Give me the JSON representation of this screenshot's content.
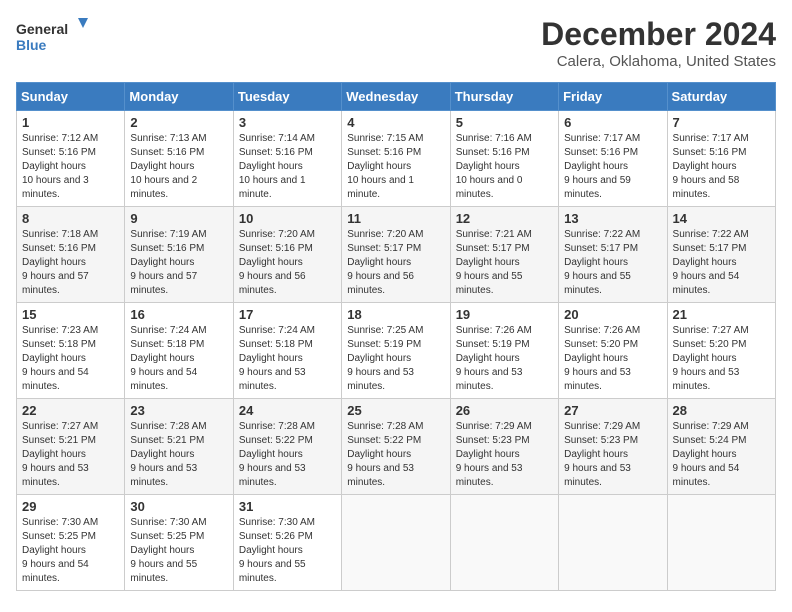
{
  "logo": {
    "line1": "General",
    "line2": "Blue"
  },
  "title": "December 2024",
  "subtitle": "Calera, Oklahoma, United States",
  "days_of_week": [
    "Sunday",
    "Monday",
    "Tuesday",
    "Wednesday",
    "Thursday",
    "Friday",
    "Saturday"
  ],
  "weeks": [
    [
      {
        "day": "1",
        "sunrise": "7:12 AM",
        "sunset": "5:16 PM",
        "daylight": "10 hours and 3 minutes."
      },
      {
        "day": "2",
        "sunrise": "7:13 AM",
        "sunset": "5:16 PM",
        "daylight": "10 hours and 2 minutes."
      },
      {
        "day": "3",
        "sunrise": "7:14 AM",
        "sunset": "5:16 PM",
        "daylight": "10 hours and 1 minute."
      },
      {
        "day": "4",
        "sunrise": "7:15 AM",
        "sunset": "5:16 PM",
        "daylight": "10 hours and 1 minute."
      },
      {
        "day": "5",
        "sunrise": "7:16 AM",
        "sunset": "5:16 PM",
        "daylight": "10 hours and 0 minutes."
      },
      {
        "day": "6",
        "sunrise": "7:17 AM",
        "sunset": "5:16 PM",
        "daylight": "9 hours and 59 minutes."
      },
      {
        "day": "7",
        "sunrise": "7:17 AM",
        "sunset": "5:16 PM",
        "daylight": "9 hours and 58 minutes."
      }
    ],
    [
      {
        "day": "8",
        "sunrise": "7:18 AM",
        "sunset": "5:16 PM",
        "daylight": "9 hours and 57 minutes."
      },
      {
        "day": "9",
        "sunrise": "7:19 AM",
        "sunset": "5:16 PM",
        "daylight": "9 hours and 57 minutes."
      },
      {
        "day": "10",
        "sunrise": "7:20 AM",
        "sunset": "5:16 PM",
        "daylight": "9 hours and 56 minutes."
      },
      {
        "day": "11",
        "sunrise": "7:20 AM",
        "sunset": "5:17 PM",
        "daylight": "9 hours and 56 minutes."
      },
      {
        "day": "12",
        "sunrise": "7:21 AM",
        "sunset": "5:17 PM",
        "daylight": "9 hours and 55 minutes."
      },
      {
        "day": "13",
        "sunrise": "7:22 AM",
        "sunset": "5:17 PM",
        "daylight": "9 hours and 55 minutes."
      },
      {
        "day": "14",
        "sunrise": "7:22 AM",
        "sunset": "5:17 PM",
        "daylight": "9 hours and 54 minutes."
      }
    ],
    [
      {
        "day": "15",
        "sunrise": "7:23 AM",
        "sunset": "5:18 PM",
        "daylight": "9 hours and 54 minutes."
      },
      {
        "day": "16",
        "sunrise": "7:24 AM",
        "sunset": "5:18 PM",
        "daylight": "9 hours and 54 minutes."
      },
      {
        "day": "17",
        "sunrise": "7:24 AM",
        "sunset": "5:18 PM",
        "daylight": "9 hours and 53 minutes."
      },
      {
        "day": "18",
        "sunrise": "7:25 AM",
        "sunset": "5:19 PM",
        "daylight": "9 hours and 53 minutes."
      },
      {
        "day": "19",
        "sunrise": "7:26 AM",
        "sunset": "5:19 PM",
        "daylight": "9 hours and 53 minutes."
      },
      {
        "day": "20",
        "sunrise": "7:26 AM",
        "sunset": "5:20 PM",
        "daylight": "9 hours and 53 minutes."
      },
      {
        "day": "21",
        "sunrise": "7:27 AM",
        "sunset": "5:20 PM",
        "daylight": "9 hours and 53 minutes."
      }
    ],
    [
      {
        "day": "22",
        "sunrise": "7:27 AM",
        "sunset": "5:21 PM",
        "daylight": "9 hours and 53 minutes."
      },
      {
        "day": "23",
        "sunrise": "7:28 AM",
        "sunset": "5:21 PM",
        "daylight": "9 hours and 53 minutes."
      },
      {
        "day": "24",
        "sunrise": "7:28 AM",
        "sunset": "5:22 PM",
        "daylight": "9 hours and 53 minutes."
      },
      {
        "day": "25",
        "sunrise": "7:28 AM",
        "sunset": "5:22 PM",
        "daylight": "9 hours and 53 minutes."
      },
      {
        "day": "26",
        "sunrise": "7:29 AM",
        "sunset": "5:23 PM",
        "daylight": "9 hours and 53 minutes."
      },
      {
        "day": "27",
        "sunrise": "7:29 AM",
        "sunset": "5:23 PM",
        "daylight": "9 hours and 53 minutes."
      },
      {
        "day": "28",
        "sunrise": "7:29 AM",
        "sunset": "5:24 PM",
        "daylight": "9 hours and 54 minutes."
      }
    ],
    [
      {
        "day": "29",
        "sunrise": "7:30 AM",
        "sunset": "5:25 PM",
        "daylight": "9 hours and 54 minutes."
      },
      {
        "day": "30",
        "sunrise": "7:30 AM",
        "sunset": "5:25 PM",
        "daylight": "9 hours and 55 minutes."
      },
      {
        "day": "31",
        "sunrise": "7:30 AM",
        "sunset": "5:26 PM",
        "daylight": "9 hours and 55 minutes."
      },
      null,
      null,
      null,
      null
    ]
  ]
}
